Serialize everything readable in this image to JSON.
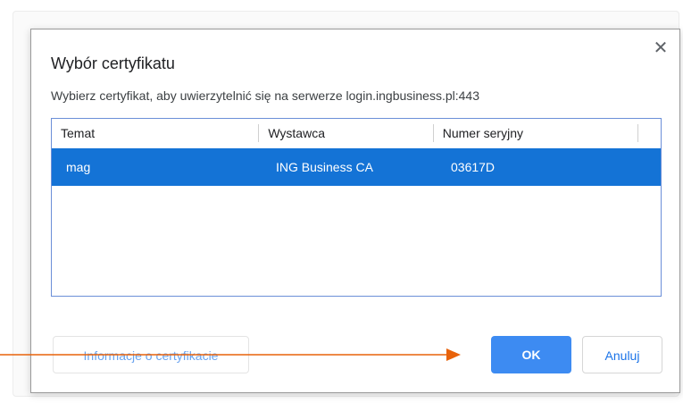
{
  "dialog": {
    "title": "Wybór certyfikatu",
    "close_symbol": "✕",
    "subtitle": "Wybierz certyfikat, aby uwierzytelnić się na serwerze login.ingbusiness.pl:443"
  },
  "table": {
    "headers": [
      "Temat",
      "Wystawca",
      "Numer seryjny"
    ],
    "rows": [
      {
        "subject": "mag",
        "issuer": "ING Business CA",
        "serial": "03617D",
        "selected": true
      }
    ]
  },
  "buttons": {
    "info_label": "Informacje o certyfikacie",
    "ok_label": "OK",
    "cancel_label": "Anuluj"
  },
  "colors": {
    "selection": "#1473d6",
    "primary_button": "#3d8bf2",
    "arrow": "#e8620a"
  },
  "icons": {
    "close": "close-icon",
    "annotation": "arrow-icon"
  }
}
